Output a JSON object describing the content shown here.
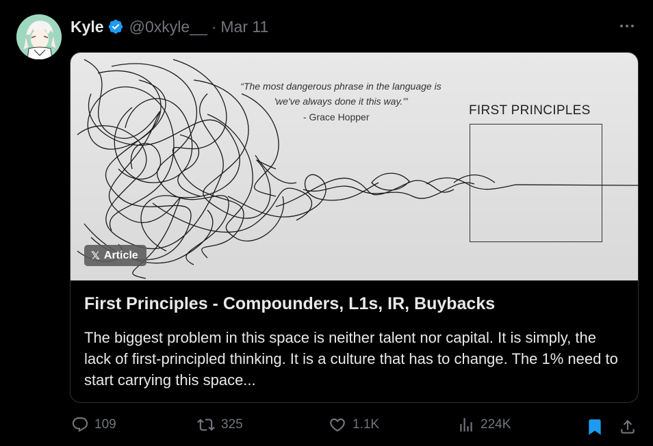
{
  "tweet": {
    "author_name": "Kyle",
    "handle": "@0xkyle__",
    "separator": "·",
    "date": "Mar 11"
  },
  "card": {
    "badge": "Article",
    "badge_icon": "x-logo-icon",
    "image": {
      "quote_line1": "“The most dangerous phrase in the language is",
      "quote_line2": "'we've always done it this way.'”",
      "quote_author": "- Grace Hopper",
      "box_label": "FIRST PRINCIPLES"
    },
    "title": "First Principles - Compounders, L1s, IR, Buybacks",
    "description": "The biggest problem in this space is neither talent nor capital. It is simply, the lack of first-principled thinking. It is a culture that has to change. The 1% need to start carrying this space..."
  },
  "actions": {
    "replies": "109",
    "reposts": "325",
    "likes": "1.1K",
    "views": "224K"
  },
  "colors": {
    "background": "#000000",
    "text": "#e7e9ea",
    "muted": "#71767b",
    "accent": "#1d9bf0"
  }
}
